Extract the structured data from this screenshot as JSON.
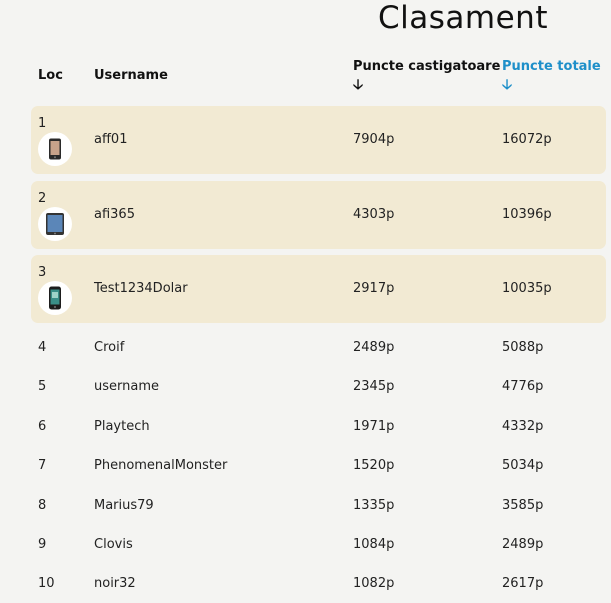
{
  "title": "Clasament",
  "headers": {
    "rank": "Loc",
    "username": "Username",
    "winning_points": "Puncte castigatoare",
    "total_points": "Puncte totale",
    "arrow": "🡣",
    "active_sort_color": "#1e8fc9"
  },
  "top_rows": [
    {
      "rank": "1",
      "username": "aff01",
      "winning": "7904p",
      "total": "16072p",
      "icon": "smartphone-icon"
    },
    {
      "rank": "2",
      "username": "afi365",
      "winning": "4303p",
      "total": "10396p",
      "icon": "tablet-icon"
    },
    {
      "rank": "3",
      "username": "Test1234Dolar",
      "winning": "2917p",
      "total": "10035p",
      "icon": "phone-icon"
    }
  ],
  "rows": [
    {
      "rank": "4",
      "username": "Croif",
      "winning": "2489p",
      "total": "5088p"
    },
    {
      "rank": "5",
      "username": "username",
      "winning": "2345p",
      "total": "4776p"
    },
    {
      "rank": "6",
      "username": "Playtech",
      "winning": "1971p",
      "total": "4332p"
    },
    {
      "rank": "7",
      "username": "PhenomenalMonster",
      "winning": "1520p",
      "total": "5034p"
    },
    {
      "rank": "8",
      "username": "Marius79",
      "winning": "1335p",
      "total": "3585p"
    },
    {
      "rank": "9",
      "username": "Clovis",
      "winning": "1084p",
      "total": "2489p"
    },
    {
      "rank": "10",
      "username": "noir32",
      "winning": "1082p",
      "total": "2617p"
    }
  ]
}
